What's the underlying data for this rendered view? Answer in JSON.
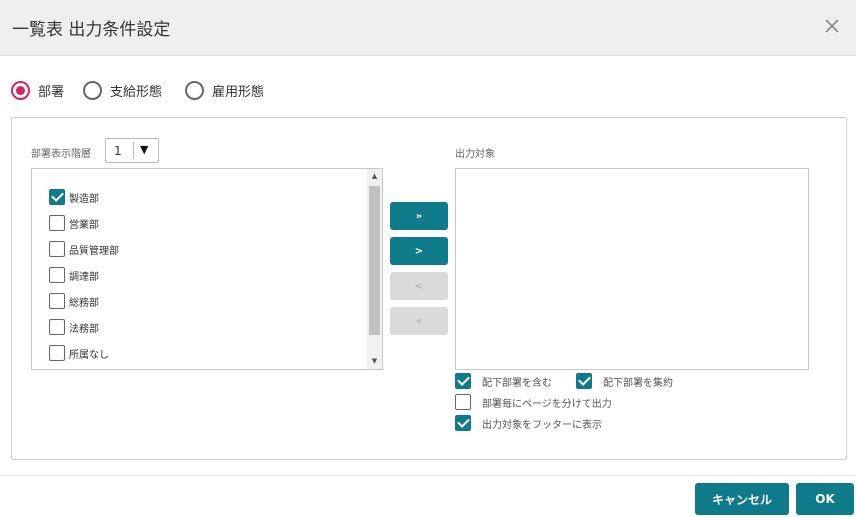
{
  "dialog": {
    "title": "一覧表 出力条件設定",
    "close_icon": "close-icon"
  },
  "mode": {
    "options": [
      {
        "label": "部署",
        "selected": true
      },
      {
        "label": "支給形態",
        "selected": false
      },
      {
        "label": "雇用形態",
        "selected": false
      }
    ],
    "accent_color": "#d6245b"
  },
  "source": {
    "level_label": "部署表示階層",
    "level_value": "1",
    "dropdown_arrow": "▼",
    "items": [
      {
        "label": "製造部",
        "checked": true
      },
      {
        "label": "営業部",
        "checked": false
      },
      {
        "label": "品質管理部",
        "checked": false
      },
      {
        "label": "調達部",
        "checked": false
      },
      {
        "label": "総務部",
        "checked": false
      },
      {
        "label": "法務部",
        "checked": false
      },
      {
        "label": "所属なし",
        "checked": false
      }
    ]
  },
  "transfer": {
    "add_all": "»",
    "add": ">",
    "remove": "<",
    "remove_all": "«"
  },
  "target": {
    "label": "出力対象",
    "items": []
  },
  "options": {
    "include_sub": {
      "label": "配下部署を含む",
      "checked": true
    },
    "aggregate_sub": {
      "label": "配下部署を集約",
      "checked": true
    },
    "page_per_dept": {
      "label": "部署毎にページを分けて出力",
      "checked": false
    },
    "show_footer": {
      "label": "出力対象をフッターに表示",
      "checked": true
    }
  },
  "footer": {
    "cancel": "キャンセル",
    "ok": "OK"
  },
  "colors": {
    "primary": "#0f7b8a",
    "header_bg": "#efefef"
  }
}
